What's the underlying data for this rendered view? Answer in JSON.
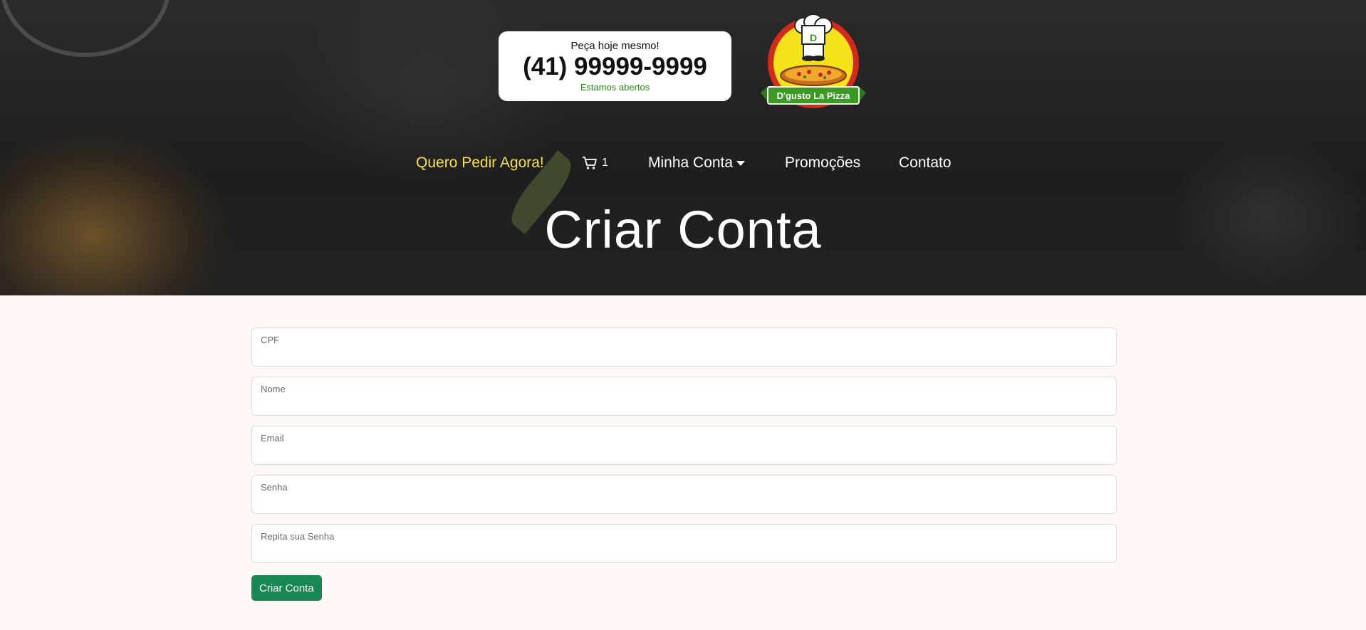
{
  "header": {
    "phone_card": {
      "tagline": "Peça hoje mesmo!",
      "phone": "(41) 99999-9999",
      "status": "Estamos abertos"
    },
    "logo": {
      "text": "D'gusto La Pizza",
      "badge_letter": "D"
    }
  },
  "nav": {
    "order_now": "Quero Pedir Agora!",
    "cart_count": "1",
    "my_account": "Minha Conta",
    "promotions": "Promoções",
    "contact": "Contato"
  },
  "page_title": "Criar Conta",
  "form": {
    "fields": [
      {
        "label": "CPF",
        "value": ""
      },
      {
        "label": "Nome",
        "value": ""
      },
      {
        "label": "Email",
        "value": ""
      },
      {
        "label": "Senha",
        "value": ""
      },
      {
        "label": "Repita sua Senha",
        "value": ""
      }
    ],
    "submit_label": "Criar Conta"
  },
  "colors": {
    "accent_yellow": "#f5e24b",
    "submit_green": "#198754",
    "status_green": "#2f8a1d",
    "page_background": "#fff8f7"
  }
}
